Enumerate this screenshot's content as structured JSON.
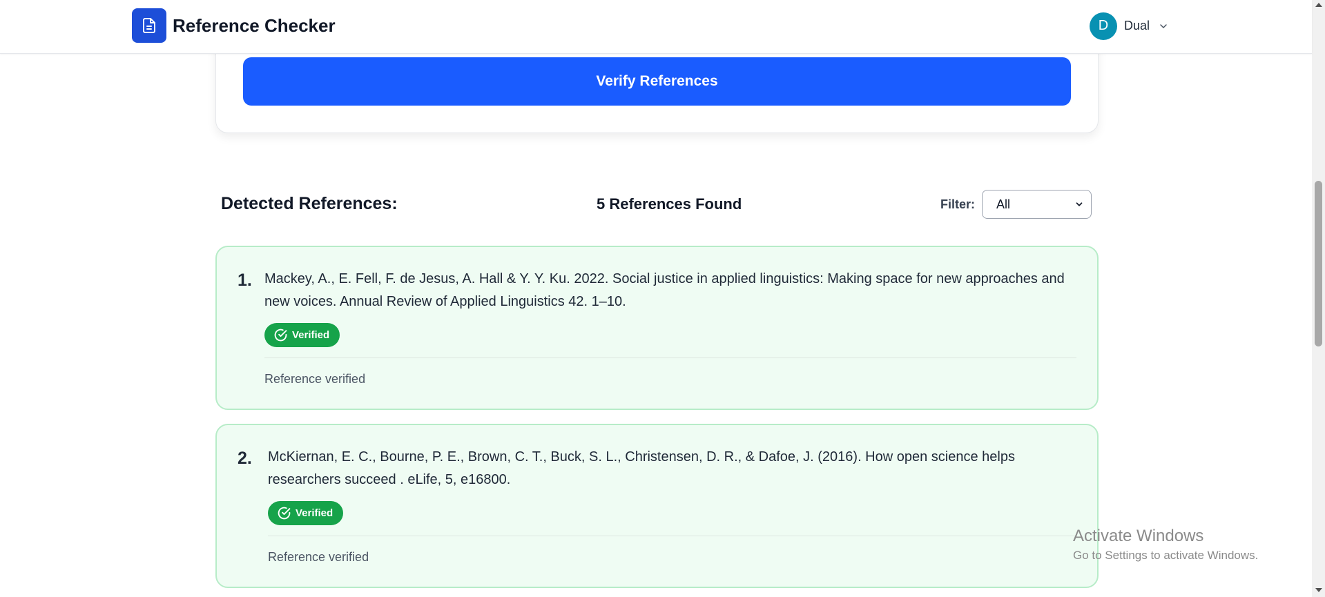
{
  "header": {
    "logo_icon": "document-icon",
    "app_title": "Reference Checker",
    "user": {
      "initial": "D",
      "name": "Dual",
      "avatar_color": "#0891b2"
    }
  },
  "verify_button_label": "Verify References",
  "references_section": {
    "title": "Detected References:",
    "found_label": "5 References Found",
    "filter_label": "Filter:",
    "filter_value": "All"
  },
  "references": [
    {
      "number": "1.",
      "text": "Mackey, A., E. Fell, F. de Jesus, A. Hall & Y. Y. Ku. 2022. Social justice in applied linguistics: Making space for new approaches and new voices. Annual Review of Applied Linguistics 42. 1–10.",
      "badge": "Verified",
      "status": "Reference verified"
    },
    {
      "number": "2.",
      "text": "McKiernan, E. C., Bourne, P. E., Brown, C. T., Buck, S. L., Christensen, D. R., & Dafoe, J. (2016). How open science helps researchers succeed . eLife, 5, e16800.",
      "badge": "Verified",
      "status": "Reference verified"
    }
  ],
  "colors": {
    "brand": "#1a5cff",
    "verified": "#16a34a",
    "card_bg": "#effcf3",
    "card_border": "#b7ecc8"
  },
  "watermark": {
    "title": "Activate Windows",
    "subtitle": "Go to Settings to activate Windows."
  }
}
